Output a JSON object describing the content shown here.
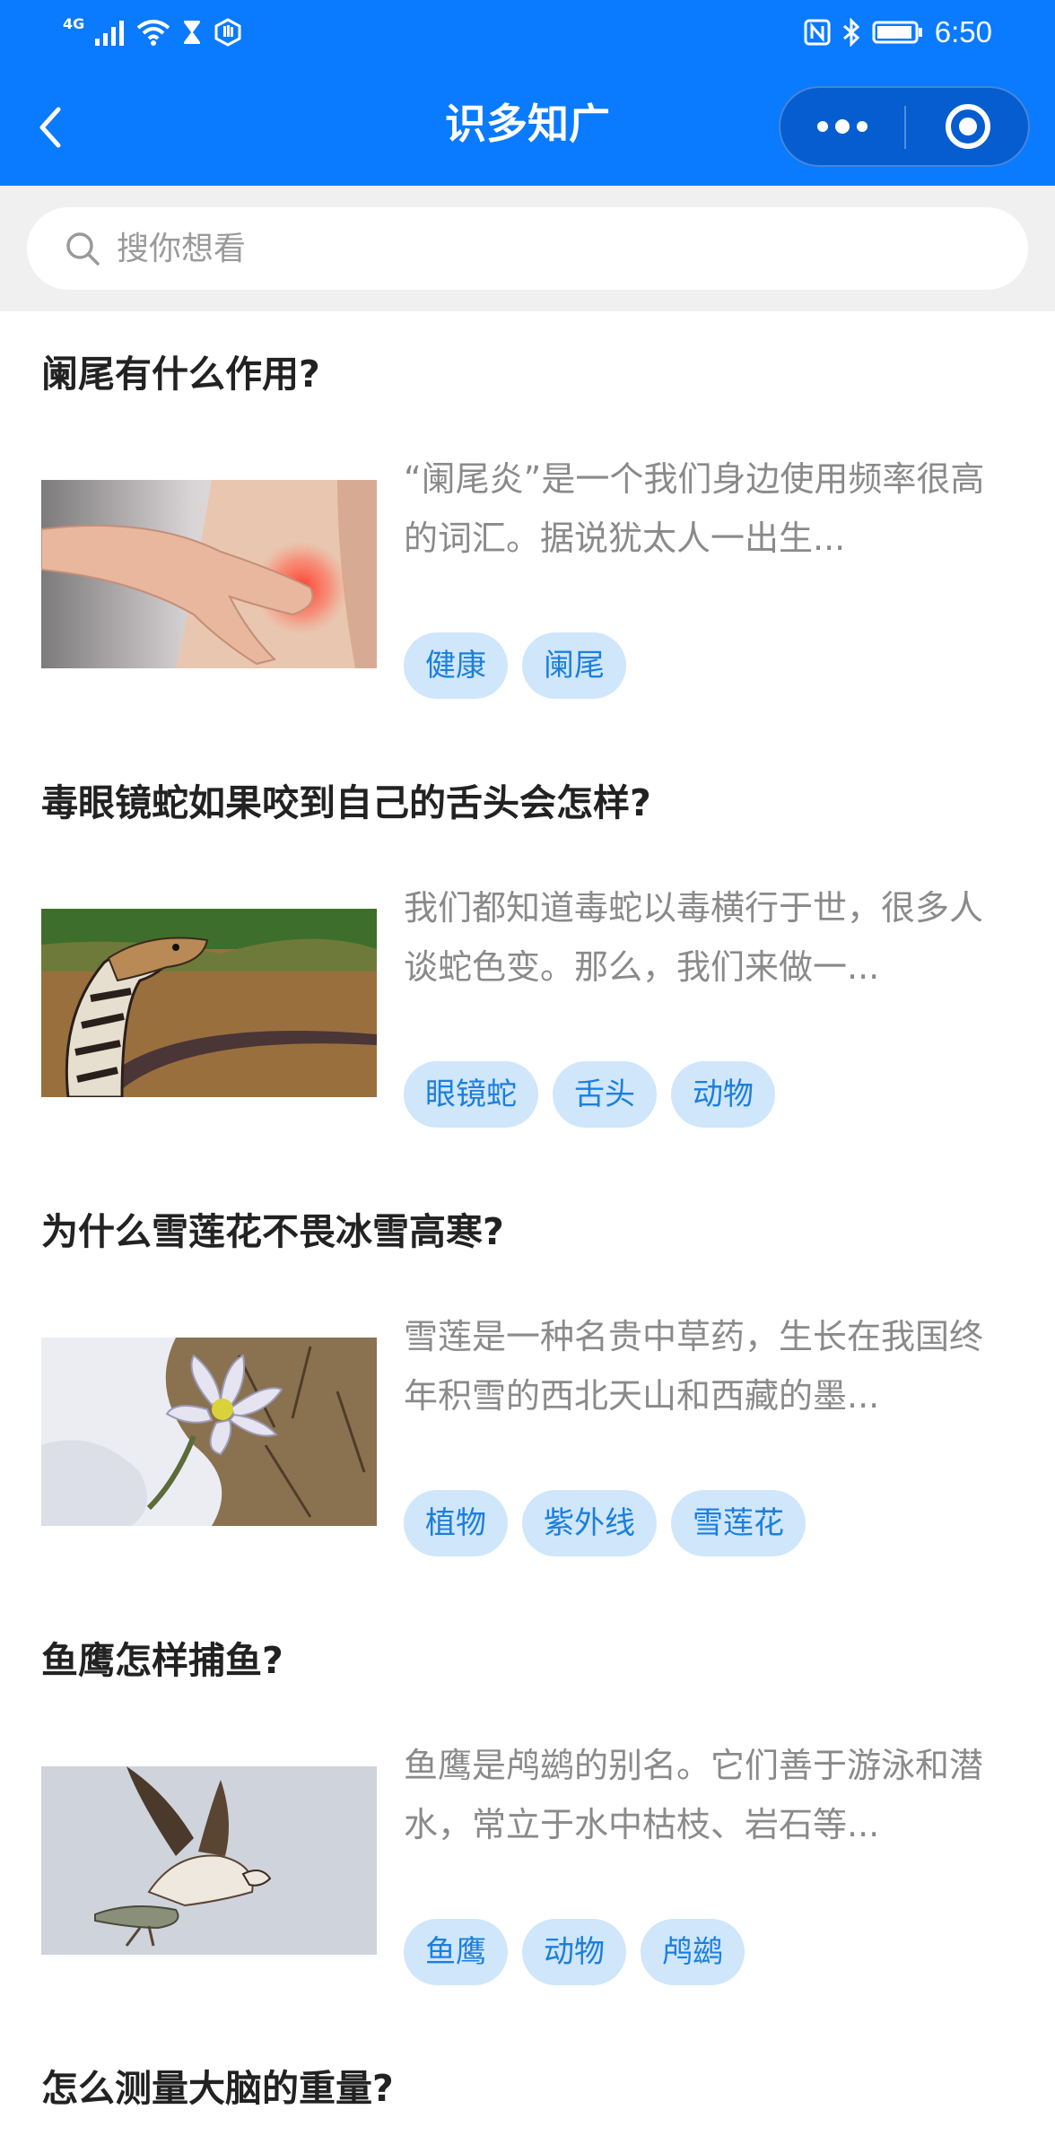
{
  "status_bar": {
    "network": "4G",
    "time": "6:50"
  },
  "nav": {
    "title": "识多知广"
  },
  "search": {
    "placeholder": "搜你想看"
  },
  "articles": [
    {
      "title": "阑尾有什么作用?",
      "summary": "“阑尾炎”是一个我们身边使用频率很高的词汇。据说犹太人一出生...",
      "tags": [
        "健康",
        "阑尾"
      ]
    },
    {
      "title": "毒眼镜蛇如果咬到自己的舌头会怎样?",
      "summary": "我们都知道毒蛇以毒横行于世，很多人谈蛇色变。那么，我们来做一...",
      "tags": [
        "眼镜蛇",
        "舌头",
        "动物"
      ]
    },
    {
      "title": "为什么雪莲花不畏冰雪高寒?",
      "summary": "雪莲是一种名贵中草药，生长在我国终年积雪的西北天山和西藏的墨...",
      "tags": [
        "植物",
        "紫外线",
        "雪莲花"
      ]
    },
    {
      "title": "鱼鹰怎样捕鱼?",
      "summary": "鱼鹰是鸬鹚的别名。它们善于游泳和潜水，常立于水中枯枝、岩石等...",
      "tags": [
        "鱼鹰",
        "动物",
        "鸬鹚"
      ]
    }
  ],
  "next_article": {
    "title": "怎么测量大脑的重量?"
  },
  "colors": {
    "brand": "#0a7aff",
    "tag_bg": "#cfe6fb",
    "tag_text": "#1c7fdc"
  }
}
